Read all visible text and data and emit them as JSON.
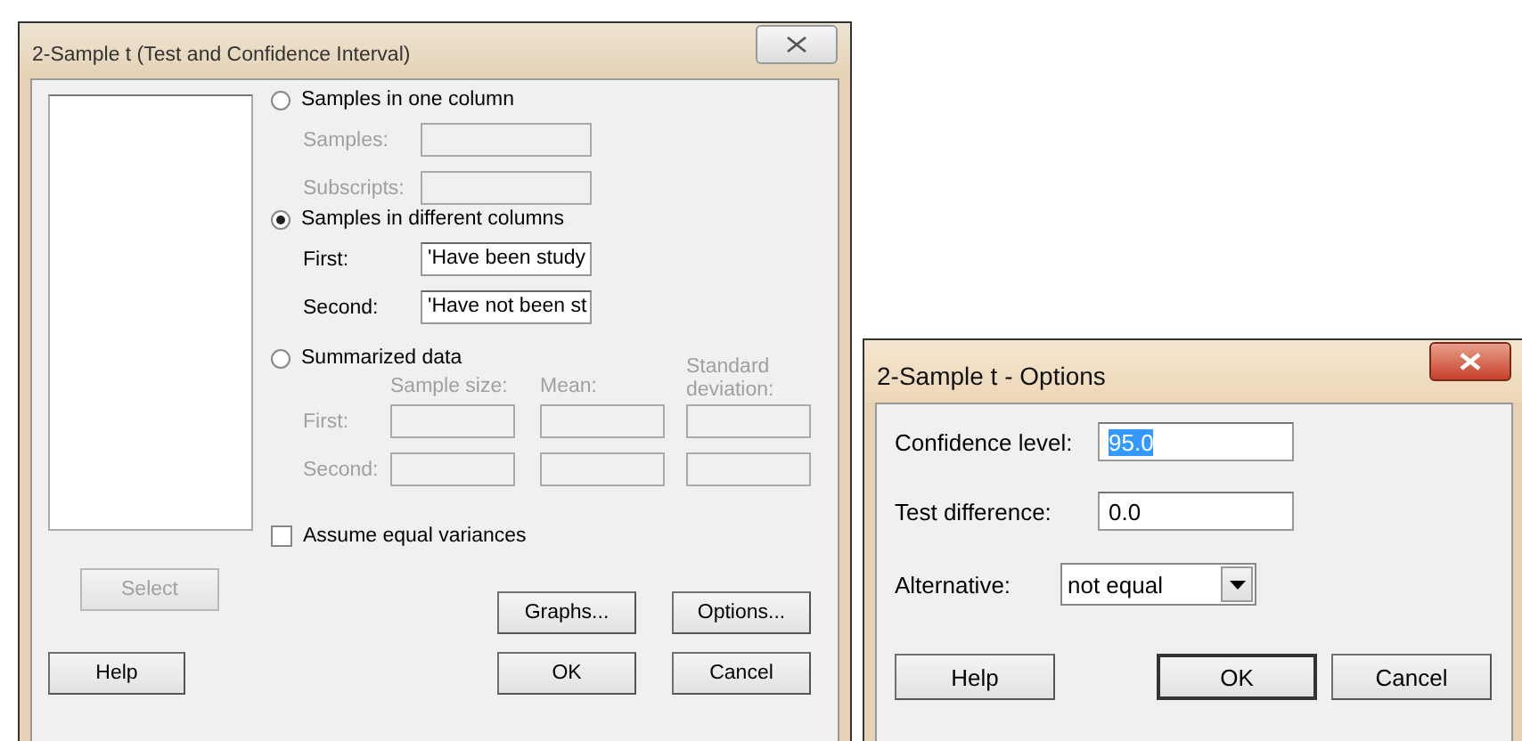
{
  "main_dialog": {
    "title": "2-Sample t (Test and Confidence Interval)",
    "active": false,
    "modes": [
      {
        "kind": "fields",
        "label": "Samples in one column",
        "selected": false,
        "fields": [
          {
            "label": "Samples:",
            "disabled": true
          },
          {
            "label": "Subscripts:",
            "disabled": true
          }
        ]
      },
      {
        "kind": "fields",
        "label": "Samples in different columns",
        "selected": true,
        "fields": [
          {
            "label": "First:",
            "value": "'Have been study",
            "disabled": false
          },
          {
            "label": "Second:",
            "value": "'Have not been st",
            "disabled": false
          }
        ]
      },
      {
        "kind": "table",
        "label": "Summarized data",
        "selected": false,
        "columns": [
          "Sample size:",
          "Mean:",
          "Standard deviation:"
        ],
        "rows": [
          {
            "label": "First:",
            "disabled": true
          },
          {
            "label": "Second:",
            "disabled": true
          }
        ]
      }
    ],
    "equal_variances": {
      "label": "Assume equal variances",
      "checked": false
    },
    "select_button": {
      "label": "Select",
      "disabled": true
    },
    "side_buttons": [
      "Graphs...",
      "Options..."
    ],
    "footer_buttons": [
      "Help",
      "OK",
      "Cancel"
    ]
  },
  "options_dialog": {
    "title": "2-Sample t - Options",
    "active": true,
    "fields": [
      {
        "kind": "text",
        "label": "Confidence level:",
        "value": "95.0",
        "highlighted": true
      },
      {
        "kind": "text",
        "label": "Test difference:",
        "value": "0.0",
        "highlighted": false
      },
      {
        "kind": "dropdown",
        "label": "Alternative:",
        "value": "not equal"
      }
    ],
    "buttons": [
      {
        "label": "Help",
        "default": false
      },
      {
        "label": "OK",
        "default": true
      },
      {
        "label": "Cancel",
        "default": false
      }
    ]
  }
}
